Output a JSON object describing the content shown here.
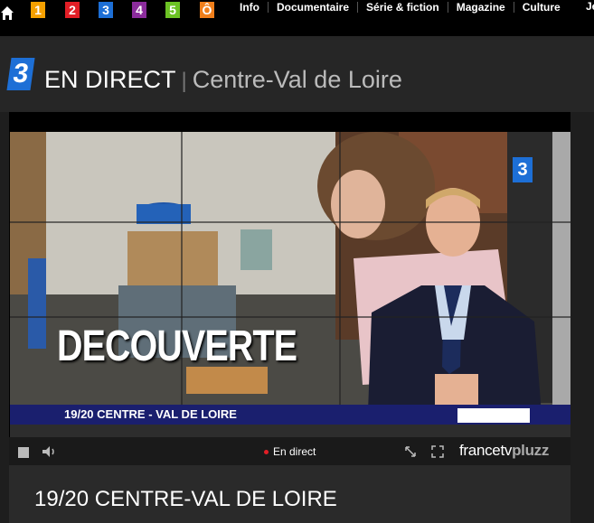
{
  "channels": [
    {
      "label": "1",
      "color": "#f5a000"
    },
    {
      "label": "2",
      "color": "#e21e26"
    },
    {
      "label": "3",
      "color": "#1d6fd6"
    },
    {
      "label": "4",
      "color": "#8b2c9c"
    },
    {
      "label": "5",
      "color": "#6cc224"
    },
    {
      "label": "Ô",
      "color": "#f07f1b"
    }
  ],
  "nav": {
    "items": [
      "Info",
      "Documentaire",
      "Série & fiction",
      "Magazine",
      "Culture"
    ],
    "overflow": "Je"
  },
  "header": {
    "logo": "3",
    "live": "EN DIRECT",
    "region": "Centre-Val de Loire"
  },
  "video": {
    "overlay_text": "DECOUVERTE",
    "lower_third": "19/20 CENTRE - VAL DE LOIRE",
    "bug": "3"
  },
  "player": {
    "live_label": "En direct",
    "brand_main": "francetv",
    "brand_sub": "pluzz",
    "accent": "#e21e26"
  },
  "program": {
    "title": "19/20 CENTRE-VAL DE LOIRE"
  }
}
